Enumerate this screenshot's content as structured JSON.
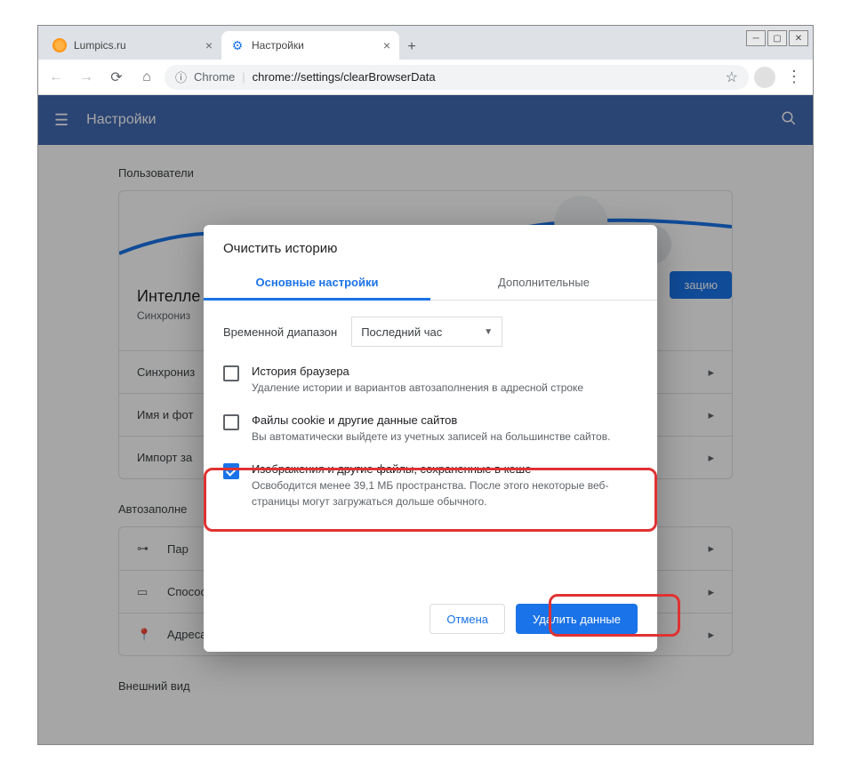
{
  "tabs": [
    {
      "title": "Lumpics.ru",
      "active": false
    },
    {
      "title": "Настройки",
      "active": true
    }
  ],
  "toolbar": {
    "chrome_label": "Chrome",
    "url_path": "chrome://settings/clearBrowserData"
  },
  "header": {
    "title": "Настройки"
  },
  "sections": {
    "users_title": "Пользователи",
    "intellect_title": "Интелле",
    "intellect_sub": "Синхрониз",
    "sync_button_partial": "зацию",
    "rows": {
      "sync": "Синхрониз",
      "name": "Имя и фот",
      "import": "Импорт за"
    },
    "autofill_title": "Автозаполне",
    "autofill_rows": {
      "passwords": "Пар",
      "payment": "Спосооы оплаты",
      "addresses": "Адреса и другие данные"
    },
    "appearance_title": "Внешний вид"
  },
  "dialog": {
    "title": "Очистить историю",
    "tab_basic": "Основные настройки",
    "tab_advanced": "Дополнительные",
    "range_label": "Временной диапазон",
    "range_value": "Последний час",
    "items": [
      {
        "checked": false,
        "title": "История браузера",
        "desc": "Удаление истории и вариантов автозаполнения в адресной строке"
      },
      {
        "checked": false,
        "title": "Файлы cookie и другие данные сайтов",
        "desc": "Вы автоматически выйдете из учетных записей на большинстве сайтов."
      },
      {
        "checked": true,
        "title": "Изображения и другие файлы, сохраненные в кеше",
        "desc": "Освободится менее 39,1 МБ пространства. После этого некоторые веб-страницы могут загружаться дольше обычного."
      }
    ],
    "cancel": "Отмена",
    "confirm": "Удалить данные"
  }
}
